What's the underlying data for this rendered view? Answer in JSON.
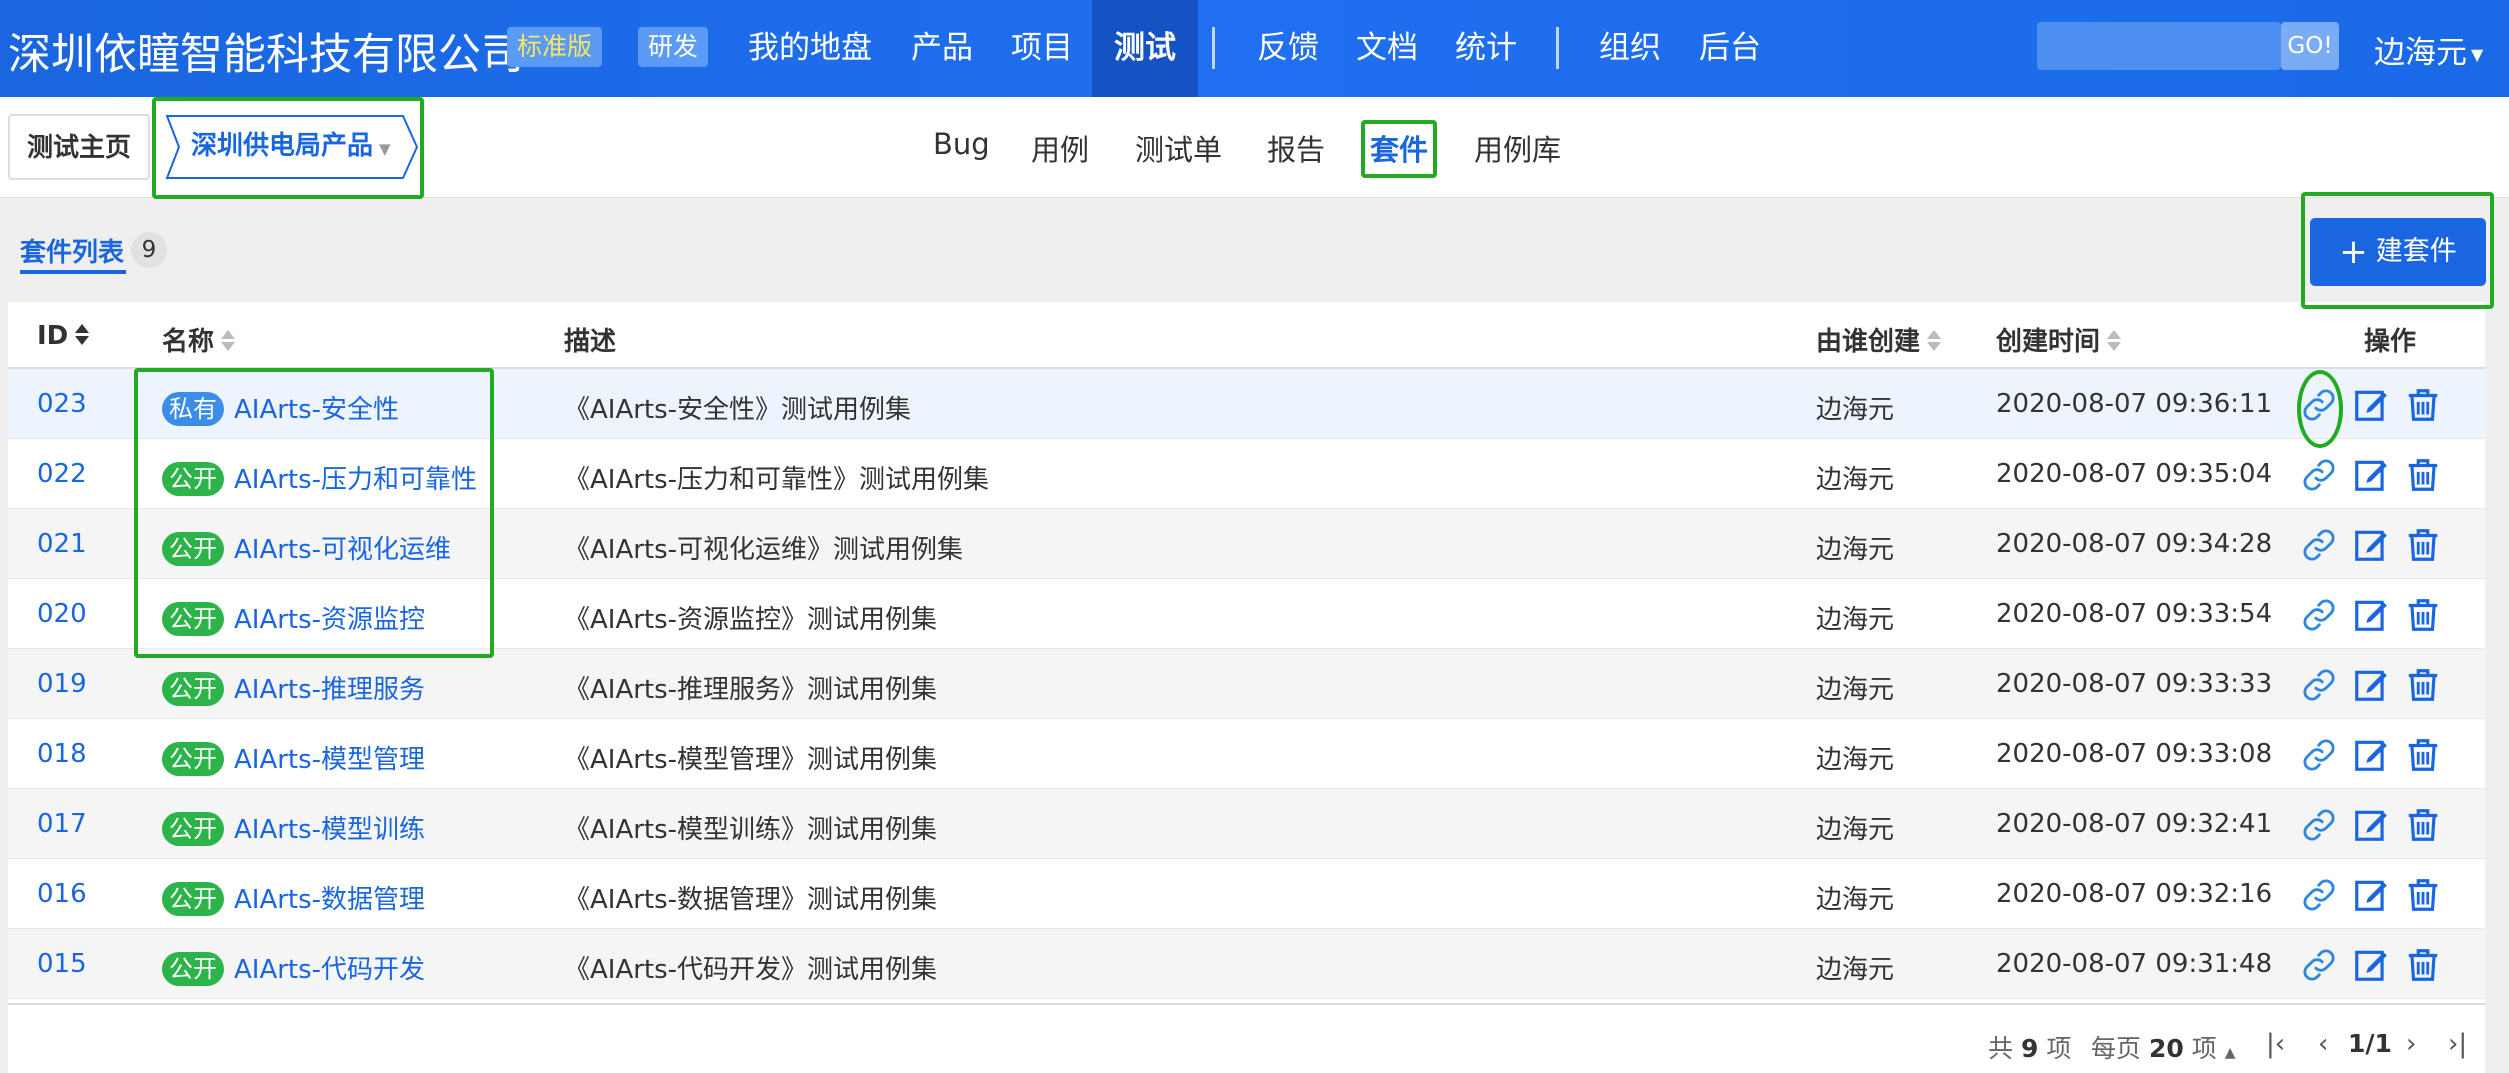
{
  "header": {
    "company": "深圳依瞳智能科技有限公司",
    "edition": "标准版",
    "role": "研发",
    "nav": [
      "我的地盘",
      "产品",
      "项目",
      "测试",
      "反馈",
      "文档",
      "统计",
      "组织",
      "后台"
    ],
    "active_nav": "测试",
    "search_button": "GO!",
    "user": "边海元"
  },
  "subnav": {
    "home": "测试主页",
    "product": "深圳供电局产品",
    "items": [
      "Bug",
      "用例",
      "测试单",
      "报告",
      "套件",
      "用例库"
    ],
    "active": "套件"
  },
  "list": {
    "title": "套件列表",
    "count": "9",
    "create_button": "建套件"
  },
  "table": {
    "columns": [
      "ID",
      "名称",
      "描述",
      "由谁创建",
      "创建时间",
      "操作"
    ],
    "rows": [
      {
        "id": "023",
        "tag": "私有",
        "name": "AIArts-安全性",
        "desc": "《AIArts-安全性》测试用例集",
        "by": "边海元",
        "time": "2020-08-07 09:36:11"
      },
      {
        "id": "022",
        "tag": "公开",
        "name": "AIArts-压力和可靠性",
        "desc": "《AIArts-压力和可靠性》测试用例集",
        "by": "边海元",
        "time": "2020-08-07 09:35:04"
      },
      {
        "id": "021",
        "tag": "公开",
        "name": "AIArts-可视化运维",
        "desc": "《AIArts-可视化运维》测试用例集",
        "by": "边海元",
        "time": "2020-08-07 09:34:28"
      },
      {
        "id": "020",
        "tag": "公开",
        "name": "AIArts-资源监控",
        "desc": "《AIArts-资源监控》测试用例集",
        "by": "边海元",
        "time": "2020-08-07 09:33:54"
      },
      {
        "id": "019",
        "tag": "公开",
        "name": "AIArts-推理服务",
        "desc": "《AIArts-推理服务》测试用例集",
        "by": "边海元",
        "time": "2020-08-07 09:33:33"
      },
      {
        "id": "018",
        "tag": "公开",
        "name": "AIArts-模型管理",
        "desc": "《AIArts-模型管理》测试用例集",
        "by": "边海元",
        "time": "2020-08-07 09:33:08"
      },
      {
        "id": "017",
        "tag": "公开",
        "name": "AIArts-模型训练",
        "desc": "《AIArts-模型训练》测试用例集",
        "by": "边海元",
        "time": "2020-08-07 09:32:41"
      },
      {
        "id": "016",
        "tag": "公开",
        "name": "AIArts-数据管理",
        "desc": "《AIArts-数据管理》测试用例集",
        "by": "边海元",
        "time": "2020-08-07 09:32:16"
      },
      {
        "id": "015",
        "tag": "公开",
        "name": "AIArts-代码开发",
        "desc": "《AIArts-代码开发》测试用例集",
        "by": "边海元",
        "time": "2020-08-07 09:31:48"
      }
    ]
  },
  "pager": {
    "total_prefix": "共",
    "total": "9",
    "total_suffix": "项",
    "per_prefix": "每页",
    "per": "20",
    "per_suffix": "项",
    "page": "1/1"
  },
  "colors": {
    "brand": "#1a66e0",
    "highlight": "#22aa22",
    "tag_private": "#3b8de8",
    "tag_public": "#2cb34a"
  },
  "icons": [
    "link-icon",
    "edit-icon",
    "delete-icon",
    "plus-icon",
    "sort-icon"
  ]
}
